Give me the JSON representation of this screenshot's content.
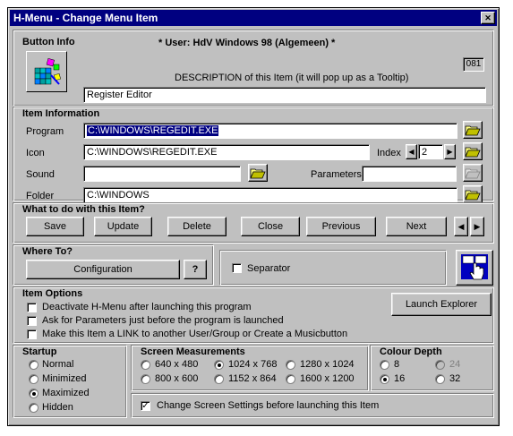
{
  "window": {
    "title": "H-Menu - Change Menu Item"
  },
  "button_info": {
    "group_title": "Button Info",
    "user_label": "* User: HdV Windows 98 (Algemeen) *",
    "number": "081",
    "description_label": "DESCRIPTION of this Item (it will pop up as a Tooltip)",
    "description_value": "Register Editor"
  },
  "item_information": {
    "group_title": "Item Information",
    "program_label": "Program",
    "program_value": "C:\\WINDOWS\\REGEDIT.EXE",
    "icon_label": "Icon",
    "icon_value": "C:\\WINDOWS\\REGEDIT.EXE",
    "index_label": "Index",
    "index_value": "2",
    "sound_label": "Sound",
    "sound_value": "",
    "parameters_label": "Parameters",
    "parameters_value": "",
    "folder_label": "Folder",
    "folder_value": "C:\\WINDOWS"
  },
  "actions": {
    "group_title": "What to do with this Item?",
    "save": "Save",
    "update": "Update",
    "delete": "Delete",
    "close": "Close",
    "previous": "Previous",
    "next": "Next"
  },
  "where_to": {
    "group_title": "Where To?",
    "configuration": "Configuration",
    "help": "?",
    "separator_label": "Separator",
    "separator_checked": false
  },
  "item_options": {
    "group_title": "Item Options",
    "opt1": "Deactivate H-Menu after launching this program",
    "opt2": "Ask for Parameters just before the program is launched",
    "opt3": "Make this Item a LINK to another User/Group or Create a Musicbutton",
    "launch_explorer": "Launch Explorer"
  },
  "startup": {
    "group_title": "Startup",
    "options": [
      "Normal",
      "Minimized",
      "Maximized",
      "Hidden"
    ],
    "selected": "Maximized"
  },
  "screen": {
    "group_title": "Screen Measurements",
    "options": [
      "640 x 480",
      "1024 x 768",
      "1280 x 1024",
      "800 x 600",
      "1152 x 864",
      "1600 x 1200"
    ],
    "selected": "1024 x 768",
    "change_label": "Change Screen Settings before launching this Item",
    "change_checked": true
  },
  "colour": {
    "group_title": "Colour Depth",
    "options": [
      "8",
      "24",
      "16",
      "32"
    ],
    "selected": "16"
  },
  "colors": {
    "title_bar": "#000080",
    "face": "#c0c0c0",
    "selection": "#000080"
  },
  "icons": [
    "registry-editor-icon",
    "folder-open-icon",
    "hand-pointer-icon"
  ]
}
